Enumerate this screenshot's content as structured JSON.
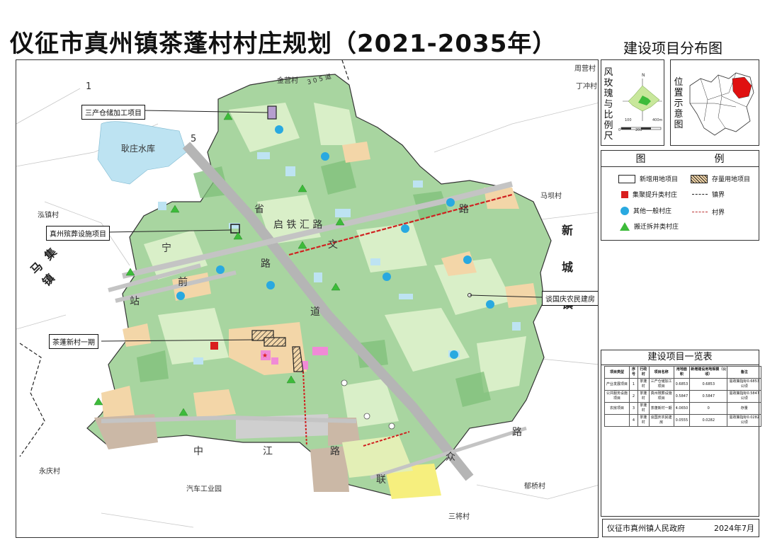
{
  "title": "仪征市真州镇茶蓬村村庄规划（2021-2035年）",
  "subtitle": "建设项目分布图",
  "colors": {
    "village_boundary": "#333333",
    "farmland": "#a8d5a0",
    "water": "#bde3f2",
    "settlement": "#f3d6a8",
    "railway_road": "#b5b5b5",
    "red_project": "#d91e1e",
    "blue_village": "#29a9e0",
    "green_village": "#3dbb3a",
    "pink_area": "#f08ad6",
    "industrial": "#c8c8c8"
  },
  "map": {
    "place_labels": {
      "jinying": "金营村",
      "zhouying": "周营村",
      "dingchong": "丁冲村",
      "yongqing": "永庆村",
      "auto_park": "汽车工业园",
      "yuqiao": "郁桥村",
      "sanjiang": "三将村",
      "mabei": "马坝村",
      "hongzhen": "泓镇村",
      "reservoir": "耿庄水库"
    },
    "road_labels": {
      "r305": "3 0 5 道",
      "qi_tie": "启 铁 汇 路",
      "sheng": "省",
      "ning": "宁",
      "qian": "前",
      "lu": "路",
      "zhan": "站",
      "dao": "道",
      "zhong": "中",
      "jiang": "江",
      "lu2": "路",
      "lian": "联",
      "zhong2": "众",
      "lu3": "路",
      "lu4": "路",
      "wen": "文",
      "one": "1",
      "five": "5"
    },
    "town_labels": {
      "ma_ji_zhen": "马集镇",
      "xin_cheng_zhen": "新城镇"
    },
    "callouts": {
      "warehouse": "三产仓储加工项目",
      "funeral_road": "真州殡葬设施项目",
      "new_village": "茶蓬新村一期",
      "house": "谈国庆农民建房"
    }
  },
  "compass": {
    "side_label": "风玫瑰与比例尺",
    "north": "N",
    "scale_ticks": [
      "0",
      "100",
      "200",
      "400m"
    ]
  },
  "location": {
    "side_label": "位置示意图"
  },
  "legend": {
    "title_left": "图",
    "title_right": "例",
    "items": [
      {
        "label": "新增用地项目",
        "symbol": "new-land"
      },
      {
        "label": "存量用地项目",
        "symbol": "stock-land"
      },
      {
        "label": "集聚提升类村庄",
        "symbol": "red-square"
      },
      {
        "label": "镇界",
        "symbol": "town-boundary"
      },
      {
        "label": "其他一般村庄",
        "symbol": "blue-circle"
      },
      {
        "label": "村界",
        "symbol": "village-boundary"
      },
      {
        "label": "搬迁拆并类村庄",
        "symbol": "green-triangle"
      }
    ]
  },
  "project_table": {
    "title": "建设项目一览表",
    "headers": [
      "项目类型",
      "序号",
      "行政村",
      "项目名称",
      "用地面积",
      "新增建设用地规模（公顷）",
      "备注"
    ],
    "rows": [
      [
        "产业发展项目",
        "1",
        "茶蓬村",
        "三产仓储加工项目",
        "0.6853",
        "0.6853",
        "需政策指标0.6853公顷"
      ],
      [
        "公共服务设施项目",
        "2",
        "茶蓬村",
        "真州殡葬设施项目",
        "0.5847",
        "0.5847",
        "需政策指标0.5847公顷"
      ],
      [
        "农房项目",
        "3",
        "茶蓬村",
        "茶蓬新村一期",
        "4.0650",
        "0",
        "存量"
      ],
      [
        "",
        "4",
        "茶蓬村",
        "谈国庆农民建房",
        "0.0555",
        "0.0282",
        "需政策指标0.0282公顷"
      ]
    ]
  },
  "footer": {
    "issuer": "仪征市真州镇人民政府",
    "date": "2024年7月"
  }
}
